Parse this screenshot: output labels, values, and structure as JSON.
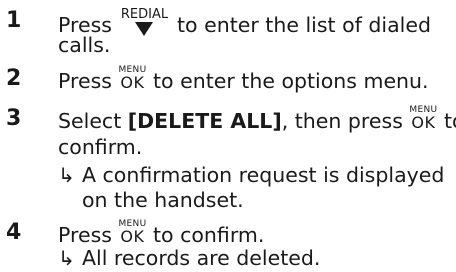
{
  "steps": [
    {
      "number": "1",
      "pre": "Press",
      "key": "REDIAL",
      "post": "to enter the list of dialed",
      "line2": "calls."
    },
    {
      "number": "2",
      "pre": "Press",
      "key_top": "MENU",
      "key_bottom": "OK",
      "post": "to enter the options menu."
    },
    {
      "number": "3",
      "pre": "Select",
      "bold": "[DELETE ALL]",
      "mid": ", then press",
      "key_top": "MENU",
      "key_bottom": "OK",
      "post": "to",
      "line2": "confirm.",
      "result_line1": "A confirmation request is displayed",
      "result_line2": "on the handset."
    },
    {
      "number": "4",
      "pre": "Press",
      "key_top": "MENU",
      "key_bottom": "OK",
      "post": "to confirm.",
      "result_line1": "All records are deleted."
    }
  ],
  "result_arrow": "↳"
}
